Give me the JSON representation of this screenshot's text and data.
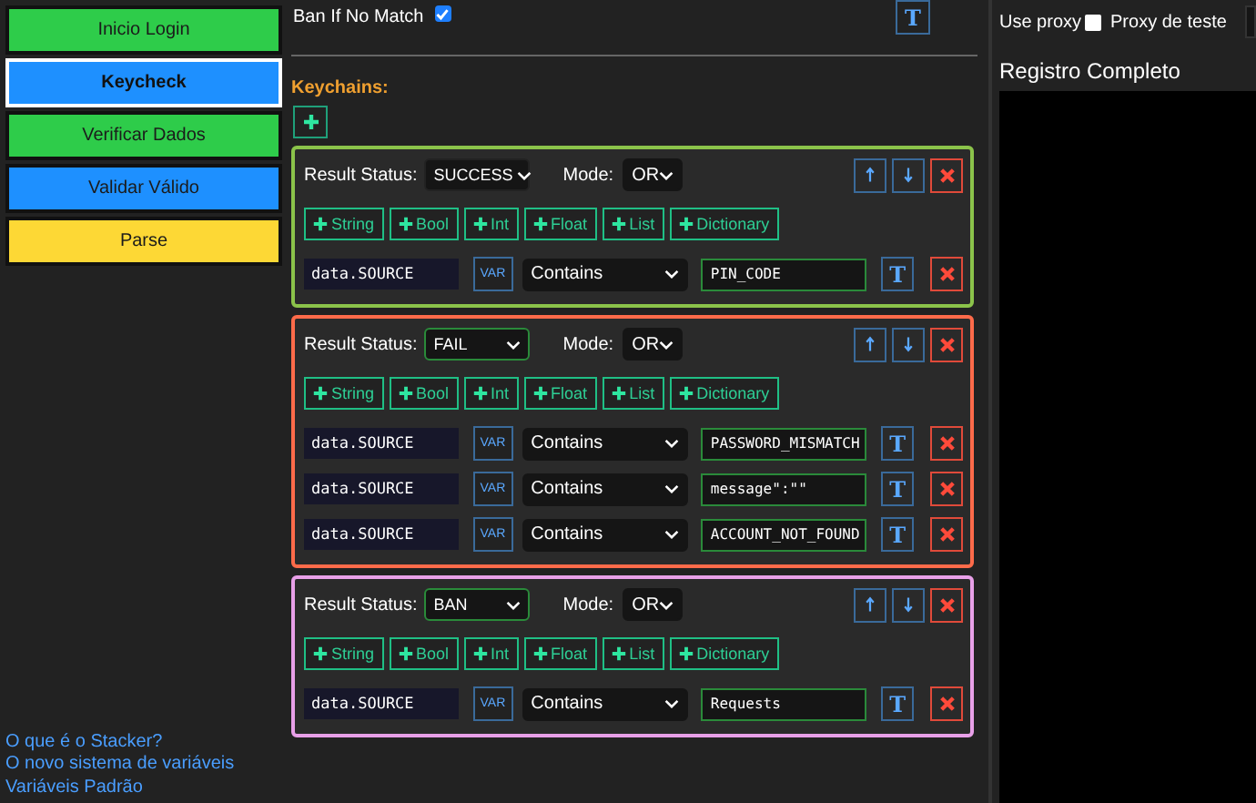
{
  "sidebar": {
    "items": [
      {
        "label": "Inicio Login",
        "color": "#2ecc4a",
        "selected": false
      },
      {
        "label": "Keycheck",
        "color": "#1e90ff",
        "selected": true
      },
      {
        "label": "Verificar Dados",
        "color": "#2ecc4a",
        "selected": false
      },
      {
        "label": "Validar Válido",
        "color": "#1e90ff",
        "selected": false
      },
      {
        "label": "Parse",
        "color": "#fdd835",
        "selected": false
      }
    ],
    "links": [
      "O que é o Stacker?",
      "O novo sistema de variáveis",
      "Variáveis Padrão"
    ]
  },
  "editor": {
    "ban_if_no_match": {
      "label": "Ban If No Match",
      "checked": true
    },
    "type_button": "T",
    "keychains_label": "Keychains:",
    "keychains": [
      {
        "color": "#8bc34a",
        "status_label": "Result Status:",
        "result_status": "SUCCESS",
        "mode_label": "Mode:",
        "mode": "OR",
        "add_buttons": [
          "String",
          "Bool",
          "Int",
          "Float",
          "List",
          "Dictionary"
        ],
        "conditions": [
          {
            "left": "data.SOURCE",
            "var": "VAR",
            "comparer": "Contains",
            "right": "PIN_CODE",
            "type_button": "T"
          }
        ]
      },
      {
        "color": "#ff6b4a",
        "status_label": "Result Status:",
        "result_status": "FAIL",
        "mode_label": "Mode:",
        "mode": "OR",
        "add_buttons": [
          "String",
          "Bool",
          "Int",
          "Float",
          "List",
          "Dictionary"
        ],
        "conditions": [
          {
            "left": "data.SOURCE",
            "var": "VAR",
            "comparer": "Contains",
            "right": "PASSWORD_MISMATCH",
            "type_button": "T"
          },
          {
            "left": "data.SOURCE",
            "var": "VAR",
            "comparer": "Contains",
            "right": "message\":\"\"",
            "type_button": "T"
          },
          {
            "left": "data.SOURCE",
            "var": "VAR",
            "comparer": "Contains",
            "right": "ACCOUNT_NOT_FOUND",
            "type_button": "T"
          }
        ]
      },
      {
        "color": "#e8a0e8",
        "status_label": "Result Status:",
        "result_status": "BAN",
        "mode_label": "Mode:",
        "mode": "OR",
        "add_buttons": [
          "String",
          "Bool",
          "Int",
          "Float",
          "List",
          "Dictionary"
        ],
        "conditions": [
          {
            "left": "data.SOURCE",
            "var": "VAR",
            "comparer": "Contains",
            "right": "Requests",
            "type_button": "T"
          }
        ]
      }
    ]
  },
  "debugger": {
    "use_proxy": {
      "label": "Use proxy",
      "checked": false
    },
    "proxy_test_label": "Proxy de teste",
    "log_title": "Registro Completo"
  }
}
